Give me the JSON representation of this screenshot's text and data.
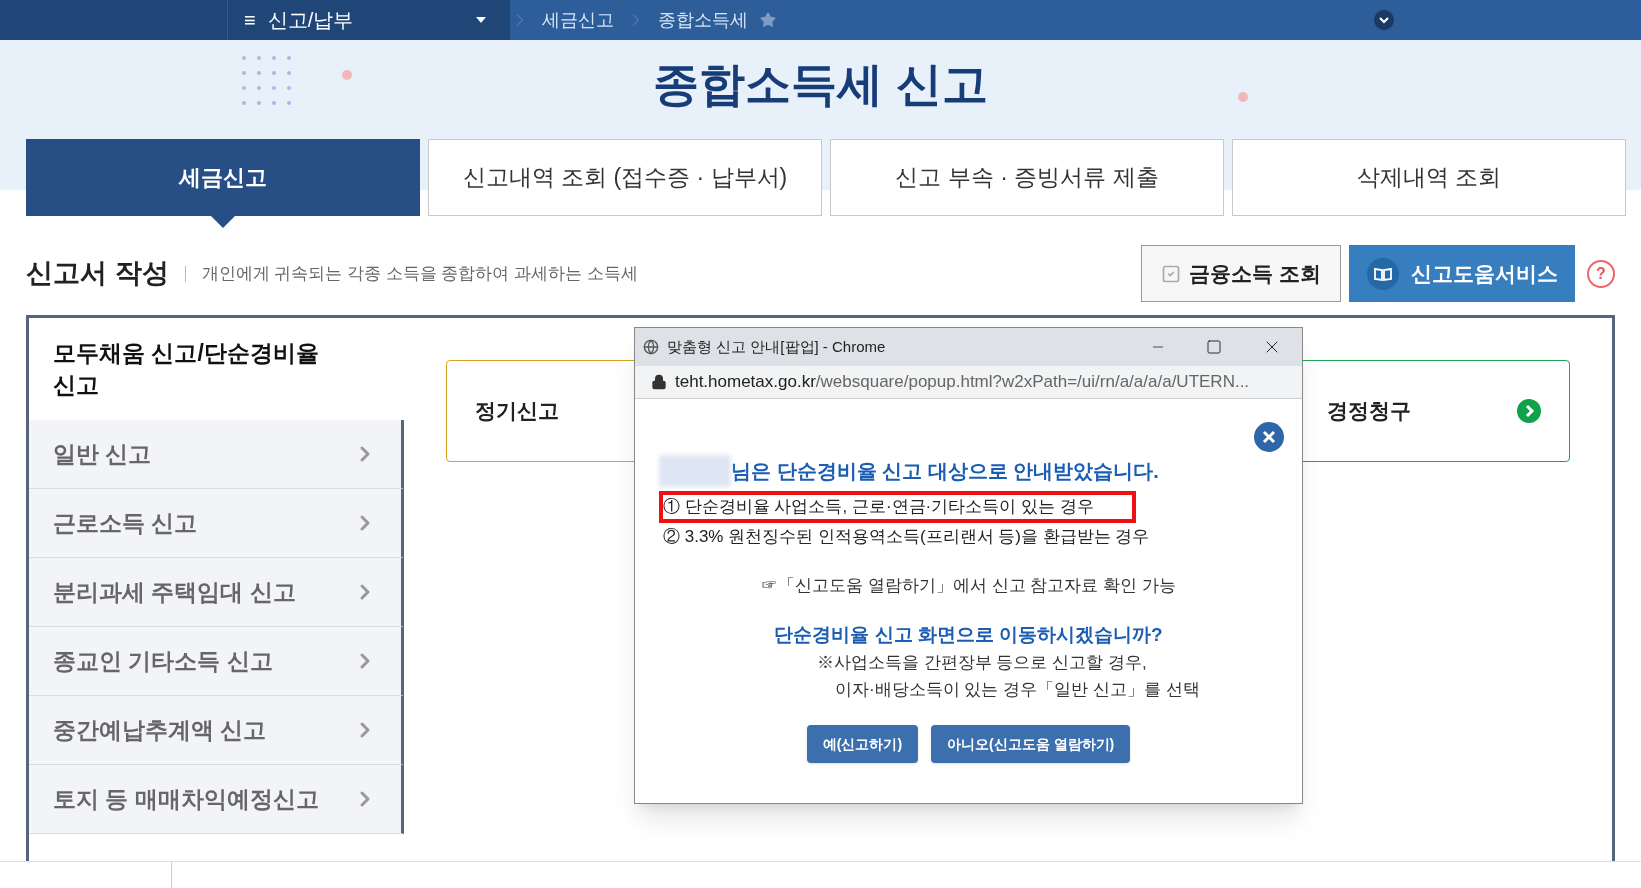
{
  "topbar": {
    "menu": {
      "icon": "≡",
      "label": "신고/납부"
    },
    "breadcrumbs": [
      {
        "label": "세금신고",
        "starred": false
      },
      {
        "label": "종합소득세",
        "starred": true
      }
    ]
  },
  "title": "종합소득세 신고",
  "tabs": [
    {
      "label": "세금신고",
      "selected": true
    },
    {
      "label": "신고내역 조회 (접수증 · 납부서)",
      "selected": false
    },
    {
      "label": "신고 부속 · 증빙서류 제출",
      "selected": false
    },
    {
      "label": "삭제내역 조회",
      "selected": false
    }
  ],
  "section": {
    "title": "신고서 작성",
    "description": "개인에게 귀속되는 각종 소득을 종합하여 과세하는 소득세",
    "buttons": [
      {
        "label": "금융소득 조회",
        "kind": "check"
      },
      {
        "label": "신고도움서비스",
        "kind": "book"
      }
    ],
    "help": "?"
  },
  "sidebar": [
    {
      "label": "모두채움 신고/단순경비율 신고",
      "selected": true
    },
    {
      "label": "일반 신고",
      "selected": false
    },
    {
      "label": "근로소득 신고",
      "selected": false
    },
    {
      "label": "분리과세 주택임대 신고",
      "selected": false
    },
    {
      "label": "종교인 기타소득 신고",
      "selected": false
    },
    {
      "label": "중간예납추계액 신고",
      "selected": false
    },
    {
      "label": "토지 등 매매차익예정신고",
      "selected": false
    }
  ],
  "cards": [
    {
      "label": "정기신고",
      "color": "#d9a520",
      "arrow": false
    },
    {
      "label": "경정청구",
      "color": "#1aa84f",
      "arrow": true
    }
  ],
  "popup": {
    "title": "맞춤형 신고 안내[팝업] - Chrome",
    "url_host": "teht.hometax.go.kr",
    "url_path": "/websquare/popup.html?w2xPath=/ui/rn/a/a/a/a/UTERN...",
    "heading": "님은 단순경비율 신고 대상으로 안내받았습니다.",
    "items": [
      {
        "text": "① 단순경비율 사업소득, 근로·연금·기타소득이 있는 경우",
        "highlighted": true
      },
      {
        "text": "② 3.3% 원천징수된 인적용역소득(프리랜서 등)을 환급받는 경우",
        "highlighted": false
      }
    ],
    "hint": "☞「신고도움 열람하기」에서 신고 참고자료 확인 가능",
    "question": "단순경비율 신고 화면으로 이동하시겠습니까?",
    "notes": [
      "※사업소득을 간편장부 등으로 신고할 경우,",
      "이자·배당소득이 있는 경우「일반 신고」를 선택"
    ],
    "buttons": [
      "예(신고하기)",
      "아니오(신고도움 열람하기)"
    ]
  }
}
